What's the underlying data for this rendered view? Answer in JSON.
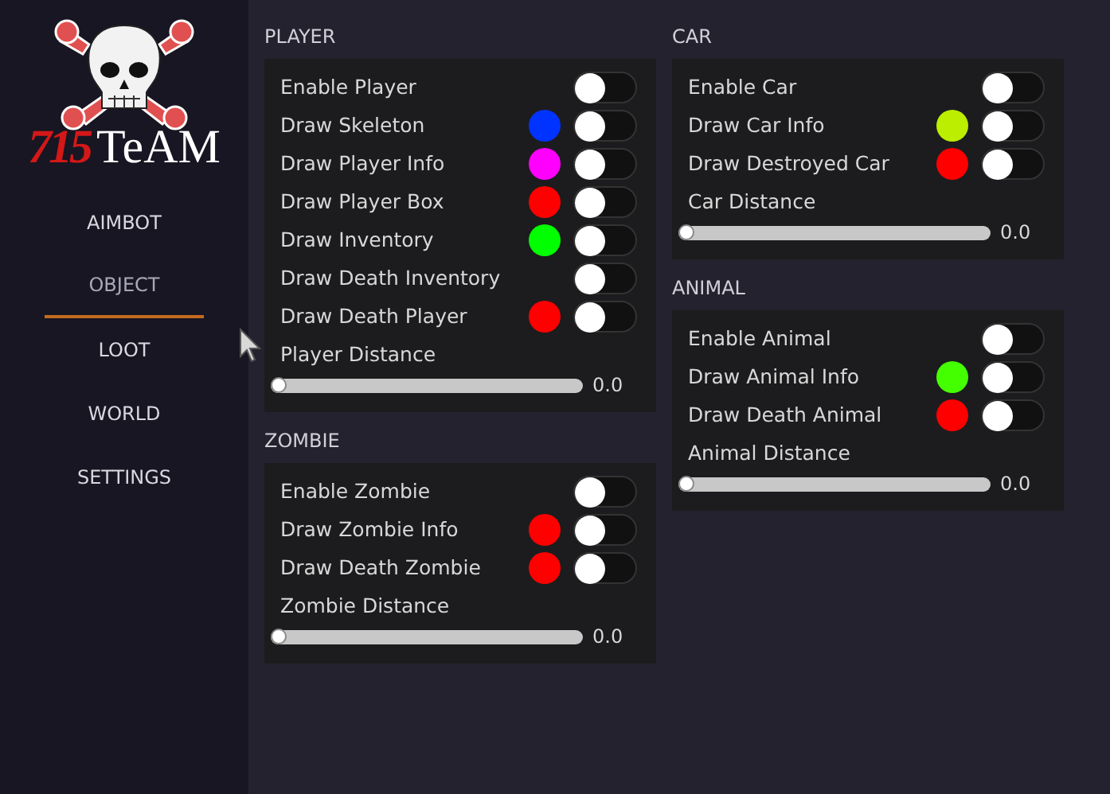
{
  "logo": {
    "number": "715",
    "word": "TeAM"
  },
  "sidebar": {
    "items": [
      {
        "label": "AIMBOT",
        "selected": false
      },
      {
        "label": "OBJECT",
        "selected": true
      },
      {
        "label": "LOOT",
        "selected": false
      },
      {
        "label": "WORLD",
        "selected": false
      },
      {
        "label": "SETTINGS",
        "selected": false
      }
    ]
  },
  "columns": [
    [
      {
        "title": "PLAYER",
        "items": [
          {
            "kind": "toggle",
            "label": "Enable Player",
            "on": false
          },
          {
            "kind": "toggle",
            "label": "Draw Skeleton",
            "on": false,
            "color": "#0033ff"
          },
          {
            "kind": "toggle",
            "label": "Draw Player Info",
            "on": false,
            "color": "#ff00ff"
          },
          {
            "kind": "toggle",
            "label": "Draw Player Box",
            "on": false,
            "color": "#ff0000"
          },
          {
            "kind": "toggle",
            "label": "Draw Inventory",
            "on": false,
            "color": "#00ff00"
          },
          {
            "kind": "toggle",
            "label": "Draw Death Inventory",
            "on": false
          },
          {
            "kind": "toggle",
            "label": "Draw Death Player",
            "on": false,
            "color": "#ff0000"
          },
          {
            "kind": "slider",
            "label": "Player Distance",
            "level": 0,
            "reading": "0.0"
          }
        ]
      },
      {
        "title": "ZOMBIE",
        "items": [
          {
            "kind": "toggle",
            "label": "Enable Zombie",
            "on": false
          },
          {
            "kind": "toggle",
            "label": "Draw Zombie Info",
            "on": false,
            "color": "#ff0000"
          },
          {
            "kind": "toggle",
            "label": "Draw Death Zombie",
            "on": false,
            "color": "#ff0000"
          },
          {
            "kind": "slider",
            "label": "Zombie Distance",
            "level": 0,
            "reading": "0.0"
          }
        ]
      }
    ],
    [
      {
        "title": "CAR",
        "items": [
          {
            "kind": "toggle",
            "label": "Enable Car",
            "on": false
          },
          {
            "kind": "toggle",
            "label": "Draw Car Info",
            "on": false,
            "color": "#bbee00"
          },
          {
            "kind": "toggle",
            "label": "Draw Destroyed Car",
            "on": false,
            "color": "#ff0000"
          },
          {
            "kind": "slider",
            "label": "Car Distance",
            "level": 0,
            "reading": "0.0"
          }
        ]
      },
      {
        "title": "ANIMAL",
        "items": [
          {
            "kind": "toggle",
            "label": "Enable Animal",
            "on": false
          },
          {
            "kind": "toggle",
            "label": "Draw Animal Info",
            "on": false,
            "color": "#44ff00"
          },
          {
            "kind": "toggle",
            "label": "Draw Death Animal",
            "on": false,
            "color": "#ff0000"
          },
          {
            "kind": "slider",
            "label": "Animal Distance",
            "level": 0,
            "reading": "0.0"
          }
        ]
      }
    ]
  ]
}
